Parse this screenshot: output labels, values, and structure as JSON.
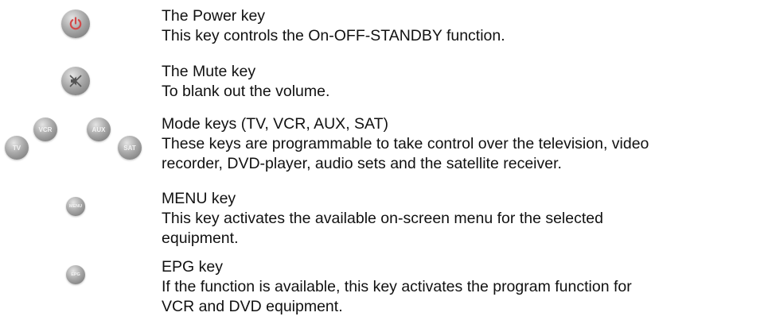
{
  "entries": [
    {
      "title": "The Power key",
      "description": [
        "This key controls the On-OFF-STANDBY function."
      ],
      "icon": "power-icon",
      "accent": "#d24a4a"
    },
    {
      "title": "The Mute key",
      "description": [
        "To blank out the volume."
      ],
      "icon": "mute-icon"
    },
    {
      "title": "Mode keys (TV, VCR, AUX, SAT)",
      "description": [
        "These keys are programmable to take control over the television, video",
        "recorder, DVD-player, audio sets and the satellite receiver."
      ],
      "keys": [
        "TV",
        "VCR",
        "AUX",
        "SAT"
      ]
    },
    {
      "title": "MENU key",
      "description": [
        "This key activates the available on-screen menu for the selected",
        "equipment."
      ],
      "key_label": "MENU"
    },
    {
      "title": "EPG key",
      "description": [
        "If the function is available, this key activates the program function for",
        "VCR and DVD equipment."
      ],
      "key_label": "EPG"
    }
  ]
}
